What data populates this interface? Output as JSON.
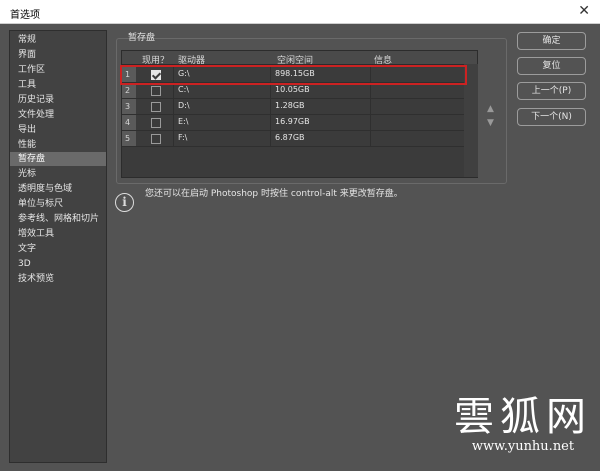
{
  "window": {
    "title": "首选项",
    "close_symbol": "✕"
  },
  "sidebar": {
    "items": [
      {
        "label": "常规"
      },
      {
        "label": "界面"
      },
      {
        "label": "工作区"
      },
      {
        "label": "工具"
      },
      {
        "label": "历史记录"
      },
      {
        "label": "文件处理"
      },
      {
        "label": "导出"
      },
      {
        "label": "性能"
      },
      {
        "label": "暂存盘",
        "selected": true
      },
      {
        "label": "光标"
      },
      {
        "label": "透明度与色域"
      },
      {
        "label": "单位与标尺"
      },
      {
        "label": "参考线、网格和切片"
      },
      {
        "label": "增效工具"
      },
      {
        "label": "文字"
      },
      {
        "label": "3D"
      },
      {
        "label": "技术预览"
      }
    ]
  },
  "scratch": {
    "section_title": "暂存盘",
    "columns": [
      "现用？",
      "驱动器",
      "空闲空间",
      "信息"
    ],
    "rows": [
      {
        "num": "1",
        "active": true,
        "drive": "G:\\",
        "free": "898.15GB",
        "info": ""
      },
      {
        "num": "2",
        "active": false,
        "drive": "C:\\",
        "free": "10.05GB",
        "info": ""
      },
      {
        "num": "3",
        "active": false,
        "drive": "D:\\",
        "free": "1.28GB",
        "info": ""
      },
      {
        "num": "4",
        "active": false,
        "drive": "E:\\",
        "free": "16.97GB",
        "info": ""
      },
      {
        "num": "5",
        "active": false,
        "drive": "F:\\",
        "free": "6.87GB",
        "info": ""
      }
    ],
    "move_up_symbol": "▲",
    "move_down_symbol": "▼",
    "info_icon": "i",
    "info_text": "您还可以在启动 Photoshop 时按住 control-alt 来更改暂存盘。"
  },
  "buttons": {
    "ok": "确定",
    "reset": "复位",
    "prev": "上一个(P)",
    "next": "下一个(N)"
  },
  "watermark": {
    "big": "雲狐网",
    "small": "www.yunhu.net"
  },
  "colors": {
    "highlight": "#cc2222",
    "background": "#535353",
    "panel": "#424242",
    "selected": "#6a6a6a"
  }
}
